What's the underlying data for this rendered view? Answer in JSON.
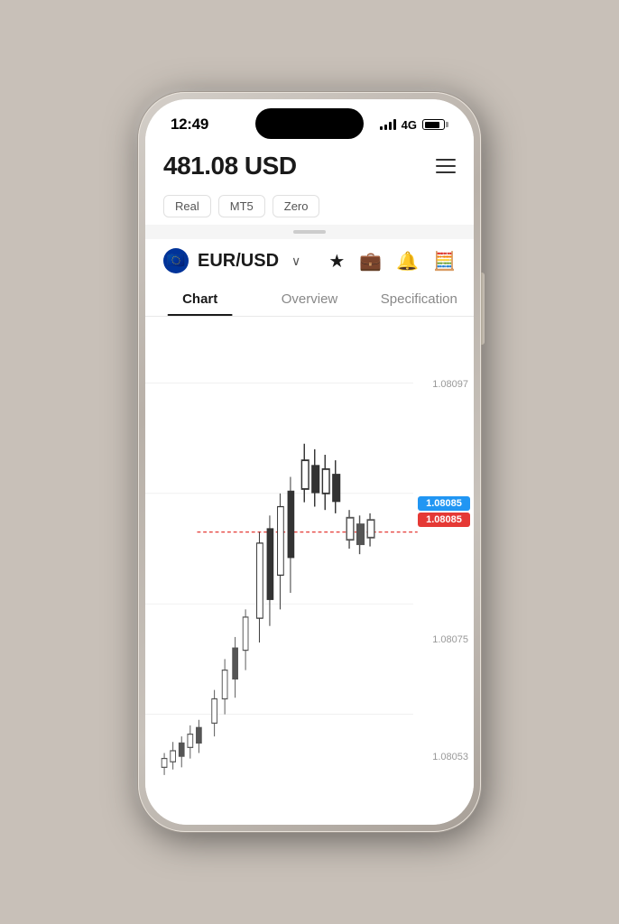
{
  "status_bar": {
    "time": "12:49",
    "network": "4G"
  },
  "header": {
    "balance": "481.08 USD",
    "menu_icon": "☰"
  },
  "account_tags": [
    {
      "label": "Real",
      "active": false
    },
    {
      "label": "MT5",
      "active": true
    },
    {
      "label": "Zero",
      "active": false
    }
  ],
  "instrument": {
    "name": "EUR/USD",
    "chevron": "∨"
  },
  "tabs": [
    {
      "label": "Chart",
      "active": true
    },
    {
      "label": "Overview",
      "active": false
    },
    {
      "label": "Specification",
      "active": false
    }
  ],
  "chart": {
    "price_levels": [
      {
        "value": "1.08097",
        "position": "top"
      },
      {
        "value": "1.08085",
        "position": "upper_mid"
      },
      {
        "value": "1.08075",
        "position": "mid"
      },
      {
        "value": "1.08053",
        "position": "lower"
      }
    ],
    "ask_price": "1.08085",
    "bid_price": "1.08085"
  },
  "icons": {
    "star": "★",
    "briefcase": "💼",
    "bell": "🔔",
    "calculator": "🧮"
  }
}
